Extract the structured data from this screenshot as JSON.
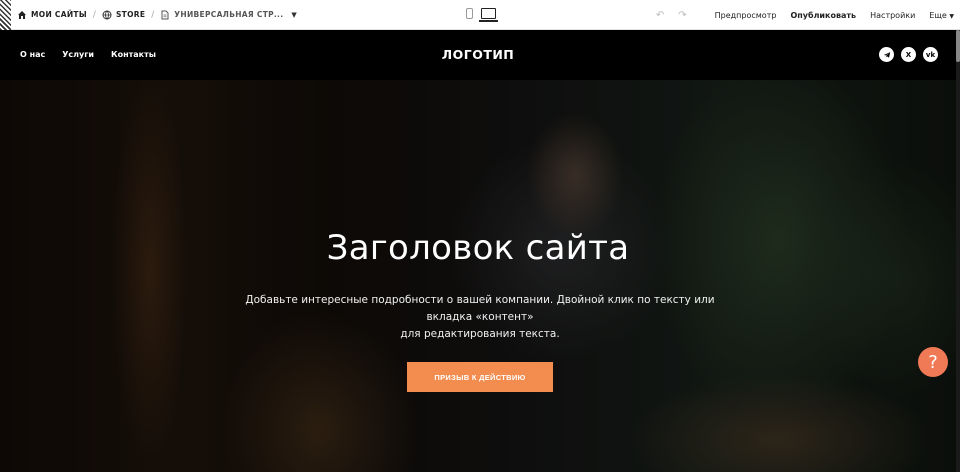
{
  "editor": {
    "breadcrumbs": [
      {
        "label": "МОИ САЙТЫ",
        "icon": "home-icon"
      },
      {
        "label": "STORE",
        "icon": "globe-icon"
      },
      {
        "label": "УНИВЕРСАЛЬНАЯ СТР...",
        "icon": "page-icon"
      }
    ],
    "preview_label": "Предпросмотр",
    "publish_label": "Опубликовать",
    "settings_label": "Настройки",
    "more_label": "Еще"
  },
  "site": {
    "nav": [
      "О нас",
      "Услуги",
      "Контакты"
    ],
    "logo": "ЛОГОТИП",
    "socials": [
      {
        "icon": "telegram-icon",
        "glyph": "➤"
      },
      {
        "icon": "x-icon",
        "glyph": "X"
      },
      {
        "icon": "vk-icon",
        "glyph": "vk"
      }
    ]
  },
  "hero": {
    "title": "Заголовок сайта",
    "subtitle_line1": "Добавьте интересные подробности о вашей компании. Двойной клик по тексту или вкладка «контент»",
    "subtitle_line2": "для редактирования текста.",
    "cta_label": "ПРИЗЫВ К ДЕЙСТВИЮ",
    "help_glyph": "?"
  },
  "colors": {
    "accent": "#f28c4f",
    "help": "#f07a55",
    "header_bg": "#000000"
  }
}
